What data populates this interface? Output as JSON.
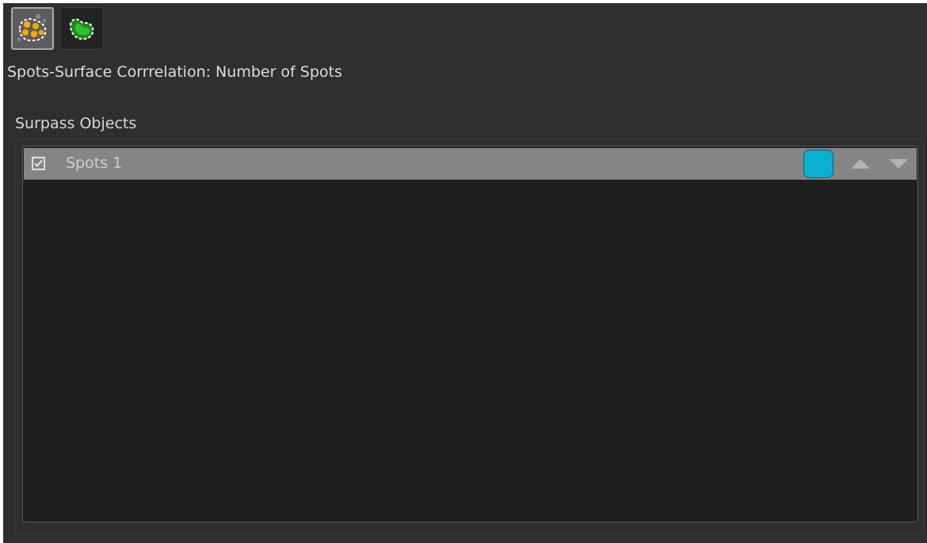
{
  "toolbar": {
    "buttons": [
      {
        "icon": "spots-in-surface-icon",
        "active": true
      },
      {
        "icon": "surface-icon",
        "active": false
      }
    ]
  },
  "panel": {
    "title": "Spots-Surface Corrrelation: Number of Spots",
    "section_label": "Surpass Objects"
  },
  "list": {
    "items": [
      {
        "label": "Spots 1",
        "checked": true,
        "color": "#0ab0cf"
      }
    ]
  },
  "colors": {
    "panel_bg": "#2f2f2f",
    "list_bg": "#1f1f1f",
    "selected_row": "#858585",
    "swatch": "#0ab0cf"
  }
}
